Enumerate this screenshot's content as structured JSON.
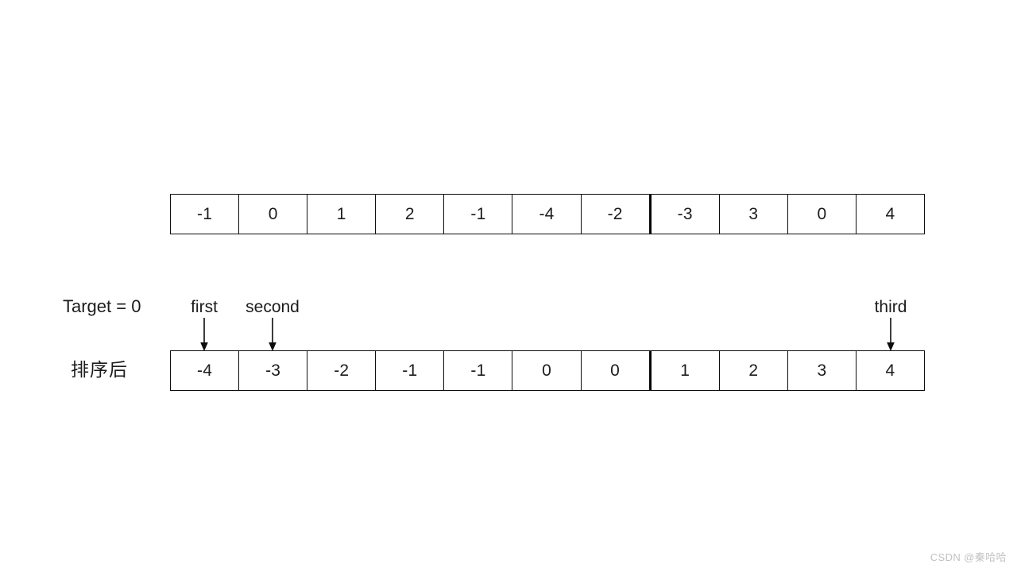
{
  "diagram": {
    "title_text": "",
    "target_label": "Target = 0",
    "sorted_caption": "排序后",
    "arrays": {
      "unsorted": {
        "name": "unsorted-array",
        "values": [
          "-1",
          "0",
          "1",
          "2",
          "-1",
          "-4",
          "-2",
          "-3",
          "3",
          "0",
          "4"
        ]
      },
      "sorted": {
        "name": "sorted-array",
        "values": [
          "-4",
          "-3",
          "-2",
          "-1",
          "-1",
          "0",
          "0",
          "1",
          "2",
          "3",
          "4"
        ]
      }
    },
    "pointers": [
      {
        "label": "first",
        "cell_index": 0,
        "value": "-4"
      },
      {
        "label": "second",
        "cell_index": 1,
        "value": "-3"
      },
      {
        "label": "third",
        "cell_index": 10,
        "value": "4"
      }
    ],
    "colors": {
      "background": "#ffffff",
      "stroke": "#0d0d0d",
      "text": "#1c1c1c",
      "watermark": "#c2c2c2"
    }
  },
  "watermark": {
    "text": "CSDN @秦哈哈"
  }
}
